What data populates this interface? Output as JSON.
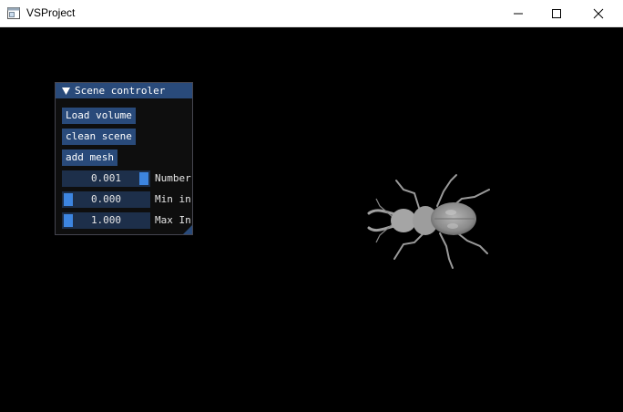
{
  "window": {
    "title": "VSProject"
  },
  "panel": {
    "title": "Scene controler",
    "buttons": {
      "load_volume": "Load volume",
      "clean_scene": "clean scene",
      "add_mesh": "add mesh"
    },
    "sliders": [
      {
        "value_text": "0.001",
        "label": "Number",
        "level": 1.0
      },
      {
        "value_text": "0.000",
        "label": "Min in",
        "level": 0.0
      },
      {
        "value_text": "1.000",
        "label": "Max In",
        "level": 0.0
      }
    ]
  },
  "colors": {
    "title_bar": "#294a7a",
    "button": "#294a7a",
    "slider_frame": "#1d2f4a",
    "slider_grab": "#3d85e0",
    "panel_bg": "#0f0f0f",
    "viewport_bg": "#000000"
  }
}
